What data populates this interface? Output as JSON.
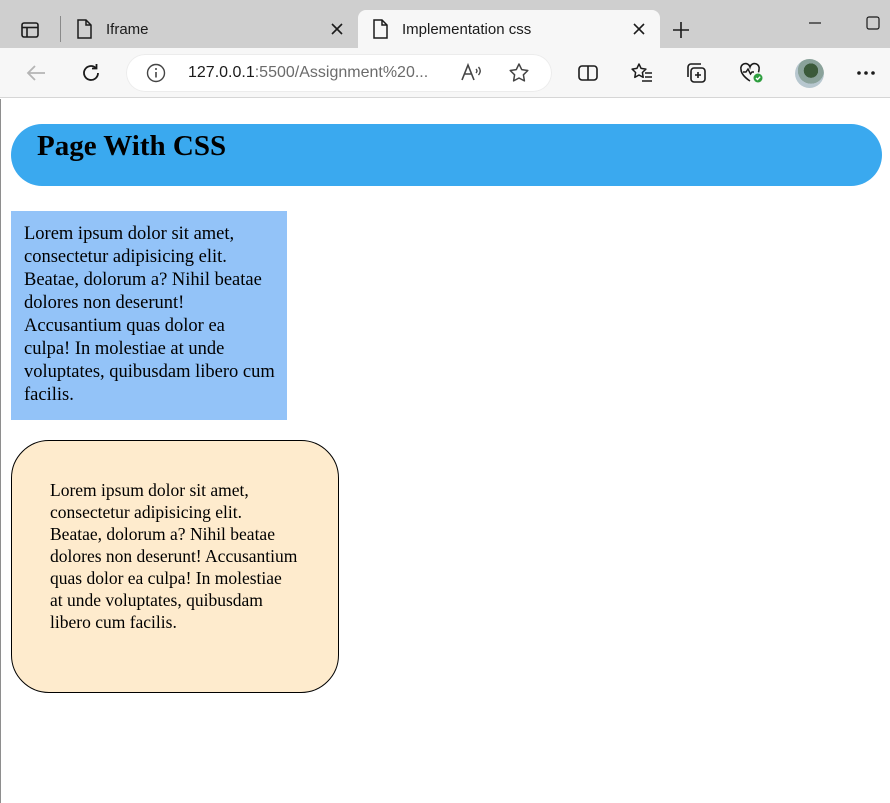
{
  "browser": {
    "tabs": [
      {
        "title": "Iframe",
        "active": false
      },
      {
        "title": "Implementation css",
        "active": true
      }
    ],
    "address": {
      "host": "127.0.0.1",
      "rest": ":5500/Assignment%20..."
    },
    "icons": {
      "tab_actions": "tab-actions-icon",
      "new_tab": "plus-icon",
      "back": "back-arrow-icon",
      "refresh": "refresh-icon",
      "info": "info-icon",
      "read_aloud": "read-aloud-icon",
      "favorite": "star-icon",
      "split": "split-screen-icon",
      "favorites": "favorites-list-icon",
      "collections": "collections-icon",
      "health": "browser-essentials-icon",
      "profile": "profile-avatar",
      "more": "more-icon"
    }
  },
  "page": {
    "heading": "Page With CSS",
    "box1_text": "Lorem ipsum dolor sit amet, consectetur adipisicing elit. Beatae, dolorum a? Nihil beatae dolores non deserunt! Accusantium quas dolor ea culpa! In molestiae at unde voluptates, quibusdam libero cum facilis.",
    "box2_text": "Lorem ipsum dolor sit amet, consectetur adipisicing elit. Beatae, dolorum a? Nihil beatae dolores non deserunt! Accusantium quas dolor ea culpa! In molestiae at unde voluptates, quibusdam libero cum facilis."
  },
  "colors": {
    "heading_bar": "#3aa9ef",
    "box1_bg": "#93c3f8",
    "box2_bg": "#feebcd",
    "tabstrip": "#cfcfcf",
    "health_badge": "#2e9e3f"
  }
}
